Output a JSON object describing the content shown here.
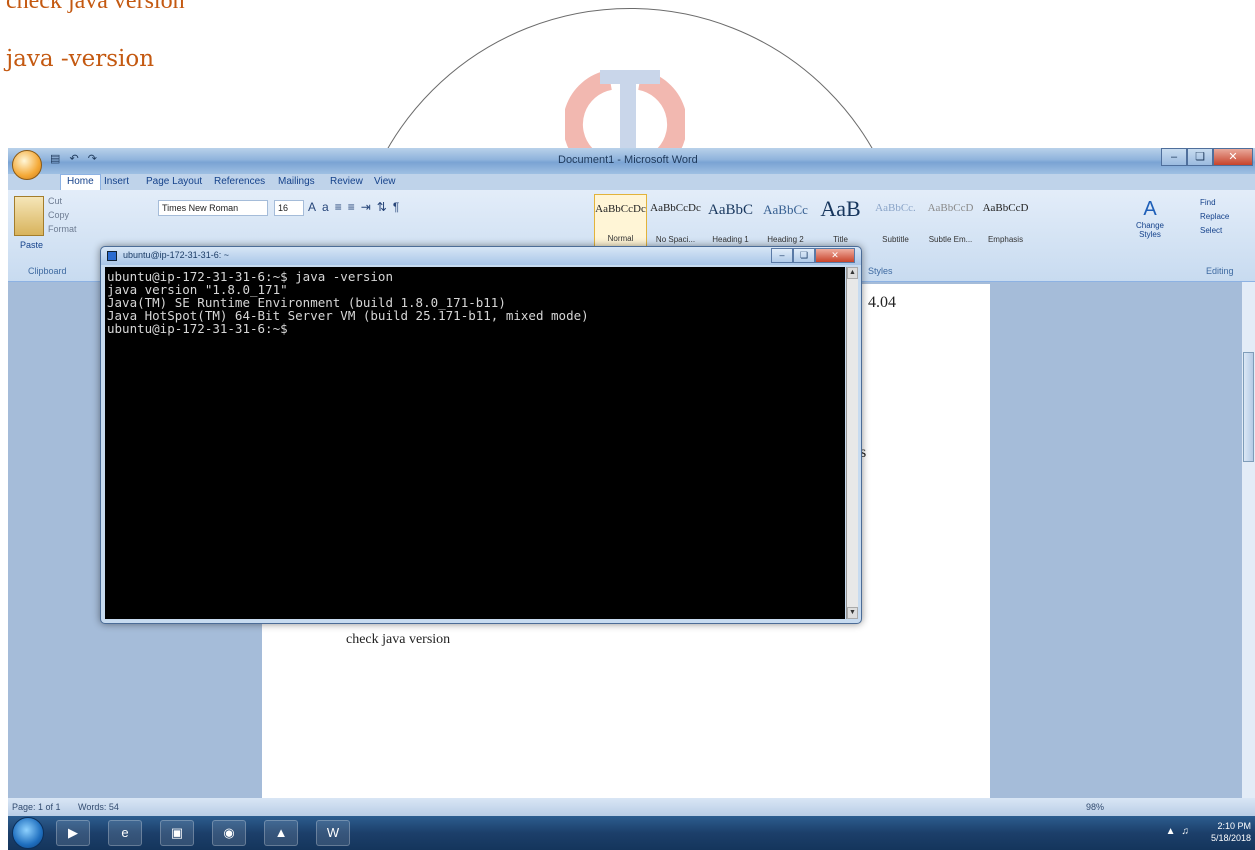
{
  "doc": {
    "top_partial": "check java version",
    "heading": "java -version"
  },
  "word": {
    "title": "Document1 - Microsoft Word",
    "office_button": "",
    "tabs": [
      "Home",
      "Insert",
      "Page Layout",
      "References",
      "Mailings",
      "Review",
      "View"
    ],
    "clipboard": {
      "paste": "Paste",
      "cut": "Cut",
      "copy": "Copy",
      "format": "Format",
      "group": "Clipboard"
    },
    "font_name": "Times New Roman",
    "font_size": "16",
    "styles": [
      {
        "preview": "AaBbCcDc",
        "name": "Normal"
      },
      {
        "preview": "AaBbCcDc",
        "name": "No Spaci..."
      },
      {
        "preview": "AaBbC",
        "name": "Heading 1"
      },
      {
        "preview": "AaBbCc",
        "name": "Heading 2"
      },
      {
        "preview": "AaB",
        "name": "Title"
      },
      {
        "preview": "AaBbCc.",
        "name": "Subtitle"
      },
      {
        "preview": "AaBbCcD",
        "name": "Subtle Em..."
      },
      {
        "preview": "AaBbCcD",
        "name": "Emphasis"
      }
    ],
    "styles_group": "Styles",
    "change_styles": "Change Styles",
    "editing": {
      "find": "Find",
      "replace": "Replace",
      "select": "Select",
      "group": "Editing"
    },
    "doc_fragments": {
      "version_fragment": "4.04",
      "s_fragment": "s",
      "caption": "check java version"
    },
    "status": {
      "page": "Page: 1 of 1",
      "words": "Words: 54",
      "zoom": "98%"
    }
  },
  "putty": {
    "title": "ubuntu@ip-172-31-31-6: ~",
    "lines": [
      "ubuntu@ip-172-31-31-6:~$ java -version",
      "java version \"1.8.0_171\"",
      "Java(TM) SE Runtime Environment (build 1.8.0_171-b11)",
      "Java HotSpot(TM) 64-Bit Server VM (build 25.171-b11, mixed mode)",
      "ubuntu@ip-172-31-31-6:~$"
    ]
  },
  "taskbar": {
    "time": "2:10 PM",
    "date": "5/18/2018"
  },
  "colors": {
    "heading": "#c45911",
    "terminal_bg": "#000000",
    "terminal_fg": "#d6d6d6"
  }
}
